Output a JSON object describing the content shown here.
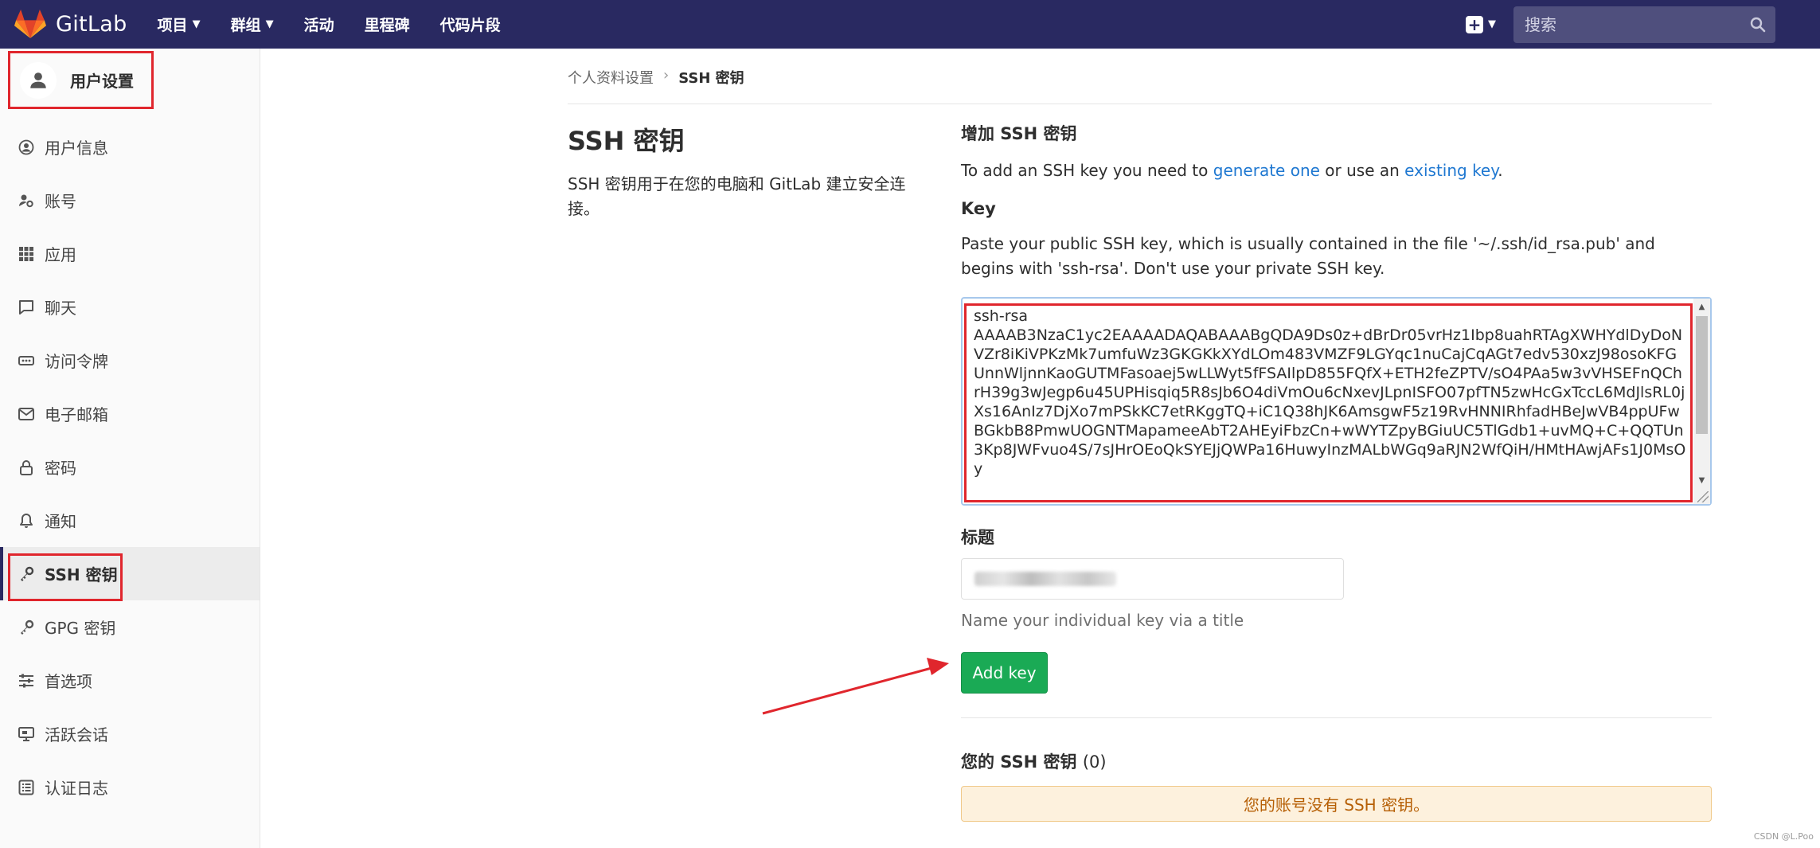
{
  "navbar": {
    "brand": "GitLab",
    "menu": [
      {
        "label": "项目",
        "has_dropdown": true
      },
      {
        "label": "群组",
        "has_dropdown": true
      },
      {
        "label": "活动",
        "has_dropdown": false
      },
      {
        "label": "里程碑",
        "has_dropdown": false
      },
      {
        "label": "代码片段",
        "has_dropdown": false
      }
    ],
    "search_placeholder": "搜索",
    "background_color": "#292961"
  },
  "sidebar": {
    "title": "用户设置",
    "items": [
      {
        "label": "用户信息",
        "icon": "user-circle-icon"
      },
      {
        "label": "账号",
        "icon": "account-gears-icon"
      },
      {
        "label": "应用",
        "icon": "applications-grid-icon"
      },
      {
        "label": "聊天",
        "icon": "chat-bubble-icon"
      },
      {
        "label": "访问令牌",
        "icon": "token-icon"
      },
      {
        "label": "电子邮箱",
        "icon": "mail-icon"
      },
      {
        "label": "密码",
        "icon": "lock-icon"
      },
      {
        "label": "通知",
        "icon": "bell-icon"
      },
      {
        "label": "SSH 密钥",
        "icon": "key-icon",
        "active": true
      },
      {
        "label": "GPG 密钥",
        "icon": "key-icon"
      },
      {
        "label": "首选项",
        "icon": "sliders-icon"
      },
      {
        "label": "活跃会话",
        "icon": "monitor-icon"
      },
      {
        "label": "认证日志",
        "icon": "list-icon"
      }
    ]
  },
  "breadcrumb": {
    "parent": "个人资料设置",
    "separator": "›",
    "current": "SSH 密钥"
  },
  "page": {
    "title": "SSH 密钥",
    "description": "SSH 密钥用于在您的电脑和 GitLab 建立安全连接。"
  },
  "add_key": {
    "section_title": "增加 SSH 密钥",
    "help_prefix": "To add an SSH key you need to ",
    "generate_link": "generate one",
    "help_middle": " or use an ",
    "existing_link": "existing key",
    "help_suffix": ".",
    "key_label": "Key",
    "key_description": "Paste your public SSH key, which is usually contained in the file '~/.ssh/id_rsa.pub' and begins with 'ssh-rsa'. Don't use your private SSH key.",
    "key_value": "ssh-rsa\nAAAAB3NzaC1yc2EAAAADAQABAAABgQDA9Ds0z+dBrDr05vrHz1Ibp8uahRTAgXWHYdlDyDoNVZr8iKiVPKzMk7umfuWz3GKGKkXYdLOm483VMZF9LGYqc1nuCajCqAGt7edv530xzJ98osoKFGUnnWljnnKaoGUTMFasoaej5wLLWyt5fFSAIlpD855FQfX+ETH2feZPTV/sO4PAa5w3vVHSEFnQChrH39g3wJegp6u45UPHisqiq5R8sJb6O4diVmOu6cNxevJLpnISFO07pfTN5zwHcGxTccL6MdJlsRL0jXs16AnIz7DjXo7mPSkKC7etRKggTQ+iC1Q38hJK6AmsgwF5z19RvHNNIRhfadHBeJwVB4ppUFwBGkbB8PmwUOGNTMapameeAbT2AHEyiFbzCn+wWYTZpyBGiuUC5TlGdb1+uvMQ+C+QQTUn3Kp8JWFvuo4S/7sJHrOEoQkSYEJjQWPa16HuwyInzMALbWGq9aRJN2WfQiH/HMtHAwjAFs1J0MsOy",
    "title_label": "标题",
    "title_help": "Name your individual key via a title",
    "submit_label": "Add key"
  },
  "your_keys": {
    "title": "您的 SSH 密钥",
    "count": "(0)",
    "empty_message": "您的账号没有 SSH 密钥。"
  },
  "watermark": "CSDN @L.Poo",
  "colors": {
    "annotation_red": "#e0262d",
    "link_blue": "#1f78d1",
    "success_green": "#1aaa55",
    "warning_bg": "#fdf1dd",
    "warning_text": "#b65f05"
  }
}
